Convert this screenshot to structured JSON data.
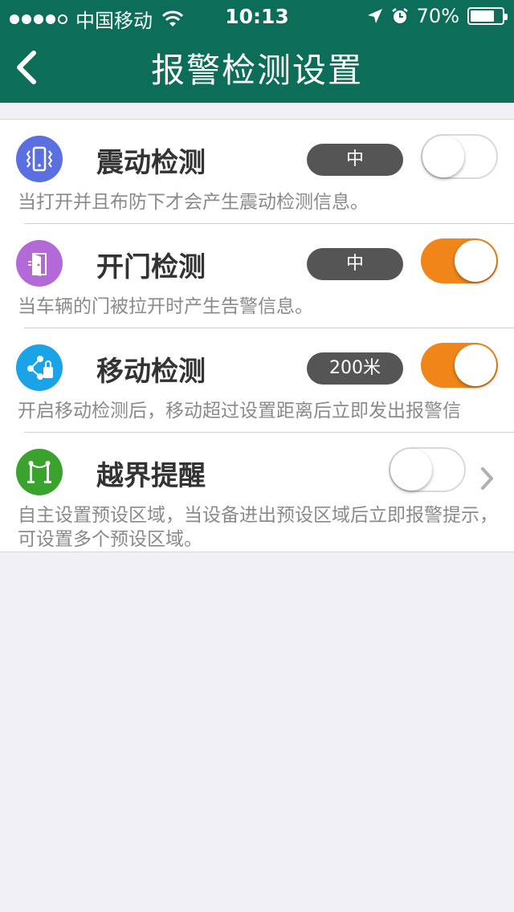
{
  "status_bar": {
    "carrier": "中国移动",
    "time": "10:13",
    "battery": "70%",
    "battery_level": 0.7,
    "signal_bars_filled": 4,
    "signal_bars_total": 5
  },
  "nav": {
    "title": "报警检测设置",
    "back_icon": "chevron-left-icon"
  },
  "colors": {
    "header_bg": "#0c6e58",
    "toggle_on": "#f08519",
    "pill_bg": "#555555",
    "background": "#efeff4"
  },
  "settings": [
    {
      "title": "震动检测",
      "icon": "vibrate-phone-icon",
      "icon_color": "#5a6fe0",
      "level": "中",
      "enabled": false,
      "description": "当打开并且布防下才会产生震动检测信息。"
    },
    {
      "title": "开门检测",
      "icon": "door-open-icon",
      "icon_color": "#b36ad6",
      "level": "中",
      "enabled": true,
      "description": "当车辆的门被拉开时产生告警信息。"
    },
    {
      "title": "移动检测",
      "icon": "location-move-icon",
      "icon_color": "#1aa3e6",
      "level": "200米",
      "enabled": true,
      "description": "开启移动检测后，移动超过设置距离后立即发出报警信"
    },
    {
      "title": "越界提醒",
      "icon": "fence-boundary-icon",
      "icon_color": "#3aa32d",
      "enabled": false,
      "description": "自主设置预设区域，当设备进出预设区域后立即报警提示，可设置多个预设区域。"
    }
  ]
}
